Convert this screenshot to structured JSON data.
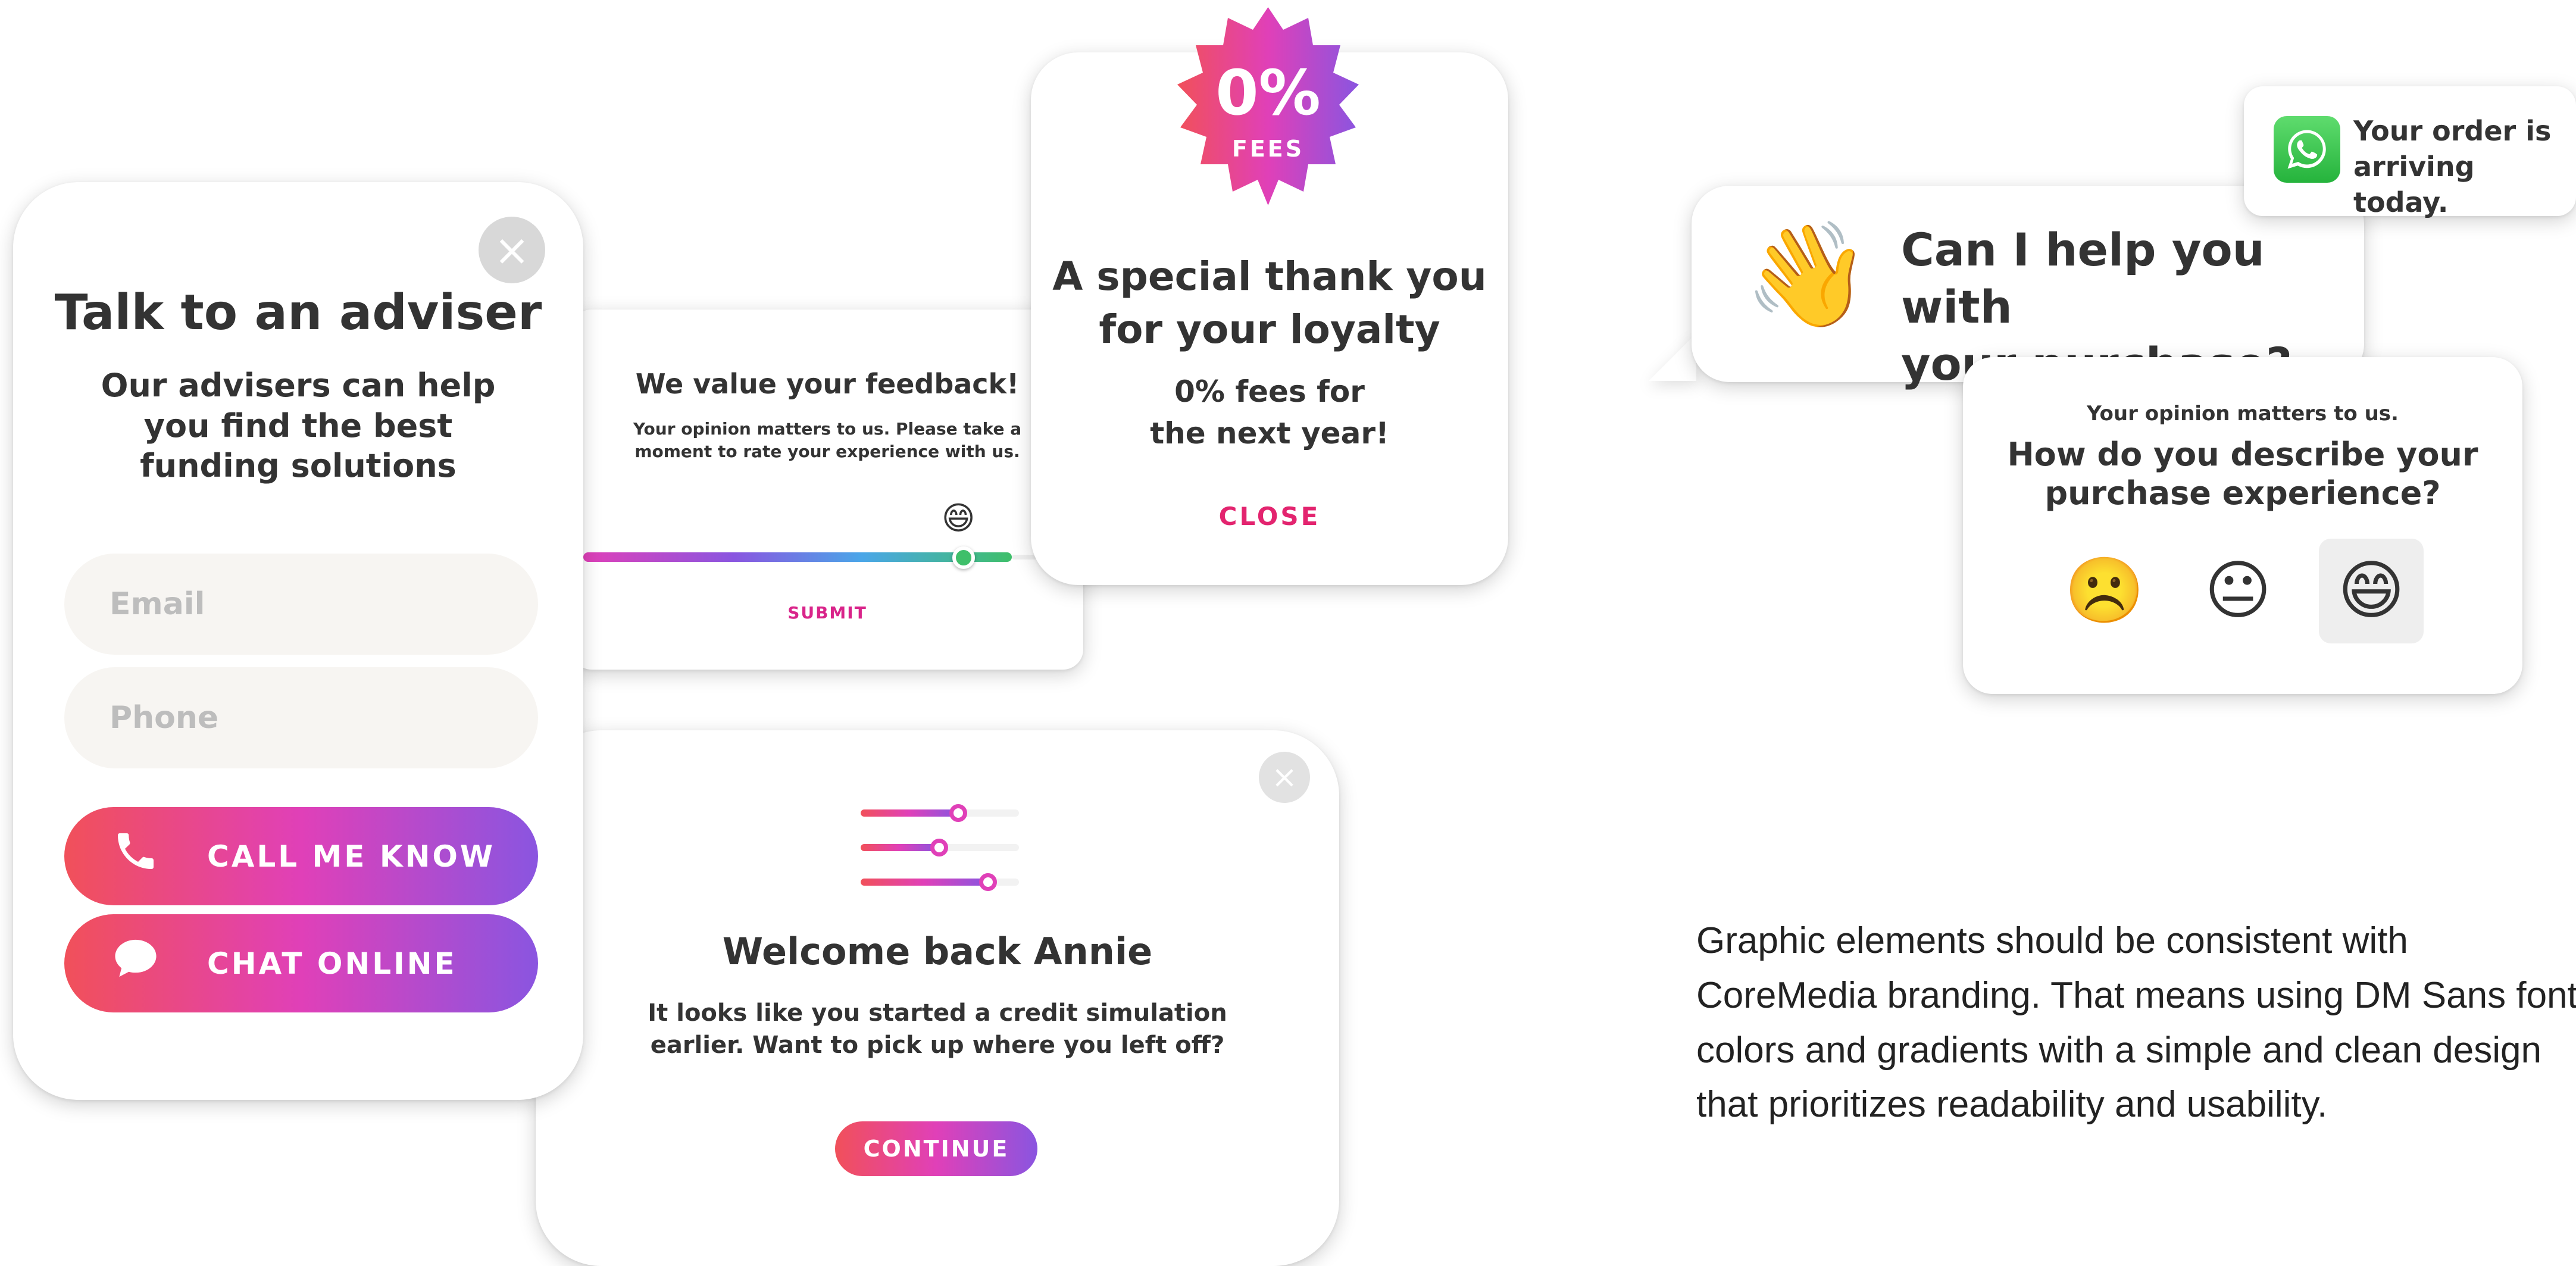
{
  "colors": {
    "gradient_start": "#f1505a",
    "gradient_mid": "#e040b8",
    "gradient_end": "#8a55e0",
    "accent_pink": "#d9248a",
    "text": "#333333",
    "slider_green": "#3fbf6a"
  },
  "feedback": {
    "title": "We value your feedback!",
    "subtitle": "Your opinion matters to us. Please take a moment to rate your experience with us.",
    "slider_emoji": "😄",
    "slider_level_percent": 86,
    "submit_label": "SUBMIT"
  },
  "adviser": {
    "close_icon": "×",
    "title": "Talk to an adviser",
    "subtitle": "Our advisers can help you find the best funding solutions",
    "email_placeholder": "Email",
    "phone_placeholder": "Phone",
    "call_icon": "phone-icon",
    "call_label": "CALL ME KNOW",
    "chat_icon": "chat-icon",
    "chat_label": "CHAT ONLINE"
  },
  "welcome": {
    "close_icon": "×",
    "sliders_percent": [
      62,
      50,
      82
    ],
    "title": "Welcome back Annie",
    "text": "It looks like you started a credit simulation earlier. Want to pick up where you left off?",
    "continue_label": "CONTINUE"
  },
  "loyalty": {
    "badge_percent": "0%",
    "badge_label": "FEES",
    "title": "A special thank you for your loyalty",
    "subtitle_line1": "0% fees for",
    "subtitle_line2": "the next year!",
    "close_label": "CLOSE"
  },
  "chat_bubble": {
    "emoji": "👋",
    "text_line1": "Can I help you with",
    "text_line2": "your purchase?"
  },
  "toast": {
    "icon": "whatsapp-icon",
    "line1": "Your order is",
    "line2": "arriving today."
  },
  "rating": {
    "small_text": "Your opinion matters to us.",
    "question_line1": "How do you describe your",
    "question_line2": "purchase experience?",
    "faces": [
      "☹️",
      "😐",
      "😄"
    ],
    "selected": "😄"
  },
  "note": {
    "line1": "Graphic elements should be consistent with",
    "line2": "CoreMedia branding. That means using DM Sans font,",
    "line3": "colors and gradients with a simple and clean design",
    "line4": "that prioritizes readability and usability."
  }
}
